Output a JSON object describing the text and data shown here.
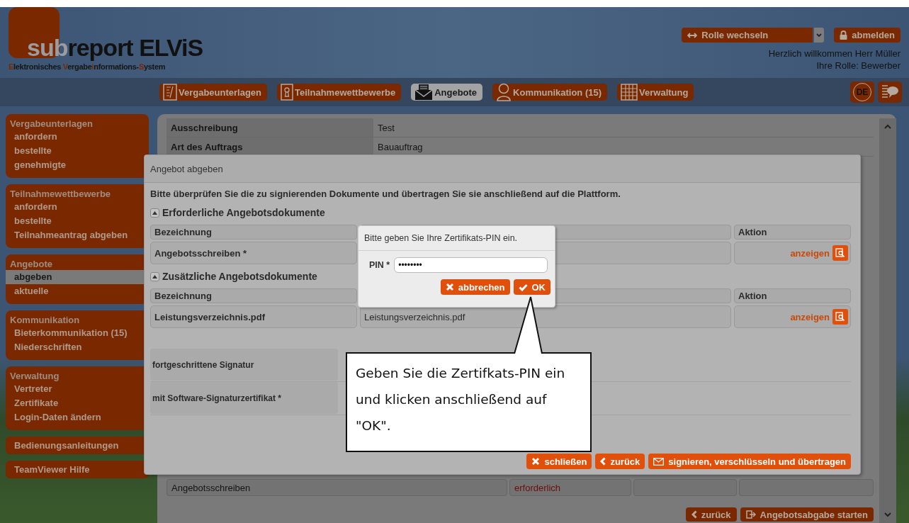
{
  "header": {
    "logo_prefix": "sub",
    "logo_main": "report ELViS",
    "tagline": [
      {
        "text": "E",
        "accent": true
      },
      {
        "text": "lektronisches ",
        "accent": false
      },
      {
        "text": "V",
        "accent": true
      },
      {
        "text": "ergabe",
        "accent": false
      },
      {
        "text": "i",
        "accent": true
      },
      {
        "text": "nformations-",
        "accent": false
      },
      {
        "text": "S",
        "accent": true
      },
      {
        "text": "ystem",
        "accent": false
      }
    ],
    "role_select": {
      "value": "Rolle wechseln"
    },
    "logout": "abmelden",
    "welcome": "Herzlich willkommen Herr Müller",
    "role": "Ihre Rolle: Bewerber"
  },
  "nav": {
    "tabs": [
      {
        "label": "Vergabeunterlagen",
        "selected": false
      },
      {
        "label": "Teilnahmewettbewerbe",
        "selected": false
      },
      {
        "label": "Angebote",
        "selected": true
      },
      {
        "label": "Kommunikation (15)",
        "selected": false
      },
      {
        "label": "Verwaltung",
        "selected": false
      }
    ],
    "language": "DE"
  },
  "sidebar": [
    {
      "kind": "group",
      "title": "Vergabeunterlagen",
      "items": [
        {
          "label": "anfordern",
          "selected": false
        },
        {
          "label": "bestellte",
          "selected": false
        },
        {
          "label": "genehmigte",
          "selected": false
        }
      ]
    },
    {
      "kind": "group",
      "title": "Teilnahmewettbewerbe",
      "items": [
        {
          "label": "anfordern",
          "selected": false
        },
        {
          "label": "bestellte",
          "selected": false
        },
        {
          "label": "Teilnahmeantrag abgeben",
          "selected": false
        }
      ]
    },
    {
      "kind": "group",
      "title": "Angebote",
      "items": [
        {
          "label": "abgeben",
          "selected": true
        },
        {
          "label": "aktuelle",
          "selected": false
        }
      ]
    },
    {
      "kind": "group",
      "title": "Kommunikation",
      "items": [
        {
          "label": "Bieterkommunikation (15)",
          "selected": false
        },
        {
          "label": "Niederschriften",
          "selected": false
        }
      ]
    },
    {
      "kind": "group",
      "title": "Verwaltung",
      "items": [
        {
          "label": "Vertreter",
          "selected": false
        },
        {
          "label": "Zertifikate",
          "selected": false
        },
        {
          "label": "Login-Daten ändern",
          "selected": false
        }
      ]
    },
    {
      "kind": "link",
      "title": "Bedienungsanleitungen"
    },
    {
      "kind": "link",
      "title": "TeamViewer Hilfe"
    }
  ],
  "details": {
    "rows": [
      {
        "label": "Ausschreibung",
        "value": "Test"
      },
      {
        "label": "Art des Auftrags",
        "value": "Bauauftrag"
      }
    ],
    "document_row": [
      "Angebotsschreiben",
      "erforderlich"
    ],
    "buttons": [
      "zurück",
      "Angebotsabgabe starten"
    ]
  },
  "modal": {
    "title": "Angebot abgeben",
    "instruction": "Bitte überprüfen Sie die zu signierenden Dokumente und übertragen Sie sie anschließend auf die Plattform.",
    "sections": [
      {
        "title": "Erforderliche Angebotsdokumente",
        "expanded": true,
        "columns": [
          "Bezeichnung",
          "",
          "Aktion"
        ],
        "rows": [
          {
            "name": "Angebotsschreiben *",
            "file": "",
            "action": "anzeigen"
          }
        ]
      },
      {
        "title": "Zusätzliche Angebotsdokumente",
        "expanded": true,
        "columns": [
          "Bezeichnung",
          "",
          "Aktion"
        ],
        "rows": [
          {
            "name": "Leistungsverzeichnis.pdf",
            "file": "Leistungsverzeichnis.pdf",
            "action": "anzeigen"
          }
        ]
      }
    ],
    "signature_rows": [
      "fortgeschrittene Signatur",
      "mit Software-Signaturzertifikat *"
    ],
    "buttons": [
      "schließen",
      "zurück",
      "signieren, verschlüsseln und übertragen"
    ]
  },
  "pin_dialog": {
    "title": "Bitte geben Sie Ihre Zertifikats-PIN ein.",
    "label": "PIN *",
    "value": "••••••••",
    "buttons": [
      "abbrechen",
      "OK"
    ]
  },
  "callout": {
    "text": "Geben Sie die Zertifkats-PIN ein und klicken anschließend auf \"OK\"."
  }
}
